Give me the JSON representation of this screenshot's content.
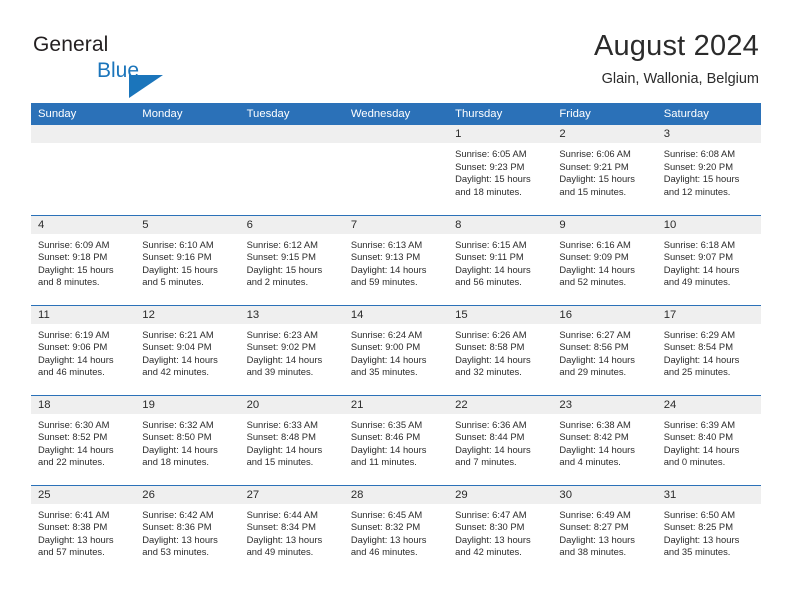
{
  "brand": {
    "name_part1": "General",
    "name_part2": "Blue",
    "logo_icon": "triangle-icon"
  },
  "header": {
    "month_title": "August 2024",
    "location": "Glain, Wallonia, Belgium"
  },
  "colors": {
    "header_blue": "#2b71b8",
    "brand_blue": "#1b75bb",
    "daynum_band": "#efefef",
    "text": "#2b2b2b"
  },
  "weekday_headers": [
    "Sunday",
    "Monday",
    "Tuesday",
    "Wednesday",
    "Thursday",
    "Friday",
    "Saturday"
  ],
  "weeks": [
    [
      {
        "day": "",
        "sunrise": "",
        "sunset": "",
        "daylight_line1": "",
        "daylight_line2": ""
      },
      {
        "day": "",
        "sunrise": "",
        "sunset": "",
        "daylight_line1": "",
        "daylight_line2": ""
      },
      {
        "day": "",
        "sunrise": "",
        "sunset": "",
        "daylight_line1": "",
        "daylight_line2": ""
      },
      {
        "day": "",
        "sunrise": "",
        "sunset": "",
        "daylight_line1": "",
        "daylight_line2": ""
      },
      {
        "day": "1",
        "sunrise": "Sunrise: 6:05 AM",
        "sunset": "Sunset: 9:23 PM",
        "daylight_line1": "Daylight: 15 hours",
        "daylight_line2": "and 18 minutes."
      },
      {
        "day": "2",
        "sunrise": "Sunrise: 6:06 AM",
        "sunset": "Sunset: 9:21 PM",
        "daylight_line1": "Daylight: 15 hours",
        "daylight_line2": "and 15 minutes."
      },
      {
        "day": "3",
        "sunrise": "Sunrise: 6:08 AM",
        "sunset": "Sunset: 9:20 PM",
        "daylight_line1": "Daylight: 15 hours",
        "daylight_line2": "and 12 minutes."
      }
    ],
    [
      {
        "day": "4",
        "sunrise": "Sunrise: 6:09 AM",
        "sunset": "Sunset: 9:18 PM",
        "daylight_line1": "Daylight: 15 hours",
        "daylight_line2": "and 8 minutes."
      },
      {
        "day": "5",
        "sunrise": "Sunrise: 6:10 AM",
        "sunset": "Sunset: 9:16 PM",
        "daylight_line1": "Daylight: 15 hours",
        "daylight_line2": "and 5 minutes."
      },
      {
        "day": "6",
        "sunrise": "Sunrise: 6:12 AM",
        "sunset": "Sunset: 9:15 PM",
        "daylight_line1": "Daylight: 15 hours",
        "daylight_line2": "and 2 minutes."
      },
      {
        "day": "7",
        "sunrise": "Sunrise: 6:13 AM",
        "sunset": "Sunset: 9:13 PM",
        "daylight_line1": "Daylight: 14 hours",
        "daylight_line2": "and 59 minutes."
      },
      {
        "day": "8",
        "sunrise": "Sunrise: 6:15 AM",
        "sunset": "Sunset: 9:11 PM",
        "daylight_line1": "Daylight: 14 hours",
        "daylight_line2": "and 56 minutes."
      },
      {
        "day": "9",
        "sunrise": "Sunrise: 6:16 AM",
        "sunset": "Sunset: 9:09 PM",
        "daylight_line1": "Daylight: 14 hours",
        "daylight_line2": "and 52 minutes."
      },
      {
        "day": "10",
        "sunrise": "Sunrise: 6:18 AM",
        "sunset": "Sunset: 9:07 PM",
        "daylight_line1": "Daylight: 14 hours",
        "daylight_line2": "and 49 minutes."
      }
    ],
    [
      {
        "day": "11",
        "sunrise": "Sunrise: 6:19 AM",
        "sunset": "Sunset: 9:06 PM",
        "daylight_line1": "Daylight: 14 hours",
        "daylight_line2": "and 46 minutes."
      },
      {
        "day": "12",
        "sunrise": "Sunrise: 6:21 AM",
        "sunset": "Sunset: 9:04 PM",
        "daylight_line1": "Daylight: 14 hours",
        "daylight_line2": "and 42 minutes."
      },
      {
        "day": "13",
        "sunrise": "Sunrise: 6:23 AM",
        "sunset": "Sunset: 9:02 PM",
        "daylight_line1": "Daylight: 14 hours",
        "daylight_line2": "and 39 minutes."
      },
      {
        "day": "14",
        "sunrise": "Sunrise: 6:24 AM",
        "sunset": "Sunset: 9:00 PM",
        "daylight_line1": "Daylight: 14 hours",
        "daylight_line2": "and 35 minutes."
      },
      {
        "day": "15",
        "sunrise": "Sunrise: 6:26 AM",
        "sunset": "Sunset: 8:58 PM",
        "daylight_line1": "Daylight: 14 hours",
        "daylight_line2": "and 32 minutes."
      },
      {
        "day": "16",
        "sunrise": "Sunrise: 6:27 AM",
        "sunset": "Sunset: 8:56 PM",
        "daylight_line1": "Daylight: 14 hours",
        "daylight_line2": "and 29 minutes."
      },
      {
        "day": "17",
        "sunrise": "Sunrise: 6:29 AM",
        "sunset": "Sunset: 8:54 PM",
        "daylight_line1": "Daylight: 14 hours",
        "daylight_line2": "and 25 minutes."
      }
    ],
    [
      {
        "day": "18",
        "sunrise": "Sunrise: 6:30 AM",
        "sunset": "Sunset: 8:52 PM",
        "daylight_line1": "Daylight: 14 hours",
        "daylight_line2": "and 22 minutes."
      },
      {
        "day": "19",
        "sunrise": "Sunrise: 6:32 AM",
        "sunset": "Sunset: 8:50 PM",
        "daylight_line1": "Daylight: 14 hours",
        "daylight_line2": "and 18 minutes."
      },
      {
        "day": "20",
        "sunrise": "Sunrise: 6:33 AM",
        "sunset": "Sunset: 8:48 PM",
        "daylight_line1": "Daylight: 14 hours",
        "daylight_line2": "and 15 minutes."
      },
      {
        "day": "21",
        "sunrise": "Sunrise: 6:35 AM",
        "sunset": "Sunset: 8:46 PM",
        "daylight_line1": "Daylight: 14 hours",
        "daylight_line2": "and 11 minutes."
      },
      {
        "day": "22",
        "sunrise": "Sunrise: 6:36 AM",
        "sunset": "Sunset: 8:44 PM",
        "daylight_line1": "Daylight: 14 hours",
        "daylight_line2": "and 7 minutes."
      },
      {
        "day": "23",
        "sunrise": "Sunrise: 6:38 AM",
        "sunset": "Sunset: 8:42 PM",
        "daylight_line1": "Daylight: 14 hours",
        "daylight_line2": "and 4 minutes."
      },
      {
        "day": "24",
        "sunrise": "Sunrise: 6:39 AM",
        "sunset": "Sunset: 8:40 PM",
        "daylight_line1": "Daylight: 14 hours",
        "daylight_line2": "and 0 minutes."
      }
    ],
    [
      {
        "day": "25",
        "sunrise": "Sunrise: 6:41 AM",
        "sunset": "Sunset: 8:38 PM",
        "daylight_line1": "Daylight: 13 hours",
        "daylight_line2": "and 57 minutes."
      },
      {
        "day": "26",
        "sunrise": "Sunrise: 6:42 AM",
        "sunset": "Sunset: 8:36 PM",
        "daylight_line1": "Daylight: 13 hours",
        "daylight_line2": "and 53 minutes."
      },
      {
        "day": "27",
        "sunrise": "Sunrise: 6:44 AM",
        "sunset": "Sunset: 8:34 PM",
        "daylight_line1": "Daylight: 13 hours",
        "daylight_line2": "and 49 minutes."
      },
      {
        "day": "28",
        "sunrise": "Sunrise: 6:45 AM",
        "sunset": "Sunset: 8:32 PM",
        "daylight_line1": "Daylight: 13 hours",
        "daylight_line2": "and 46 minutes."
      },
      {
        "day": "29",
        "sunrise": "Sunrise: 6:47 AM",
        "sunset": "Sunset: 8:30 PM",
        "daylight_line1": "Daylight: 13 hours",
        "daylight_line2": "and 42 minutes."
      },
      {
        "day": "30",
        "sunrise": "Sunrise: 6:49 AM",
        "sunset": "Sunset: 8:27 PM",
        "daylight_line1": "Daylight: 13 hours",
        "daylight_line2": "and 38 minutes."
      },
      {
        "day": "31",
        "sunrise": "Sunrise: 6:50 AM",
        "sunset": "Sunset: 8:25 PM",
        "daylight_line1": "Daylight: 13 hours",
        "daylight_line2": "and 35 minutes."
      }
    ]
  ]
}
